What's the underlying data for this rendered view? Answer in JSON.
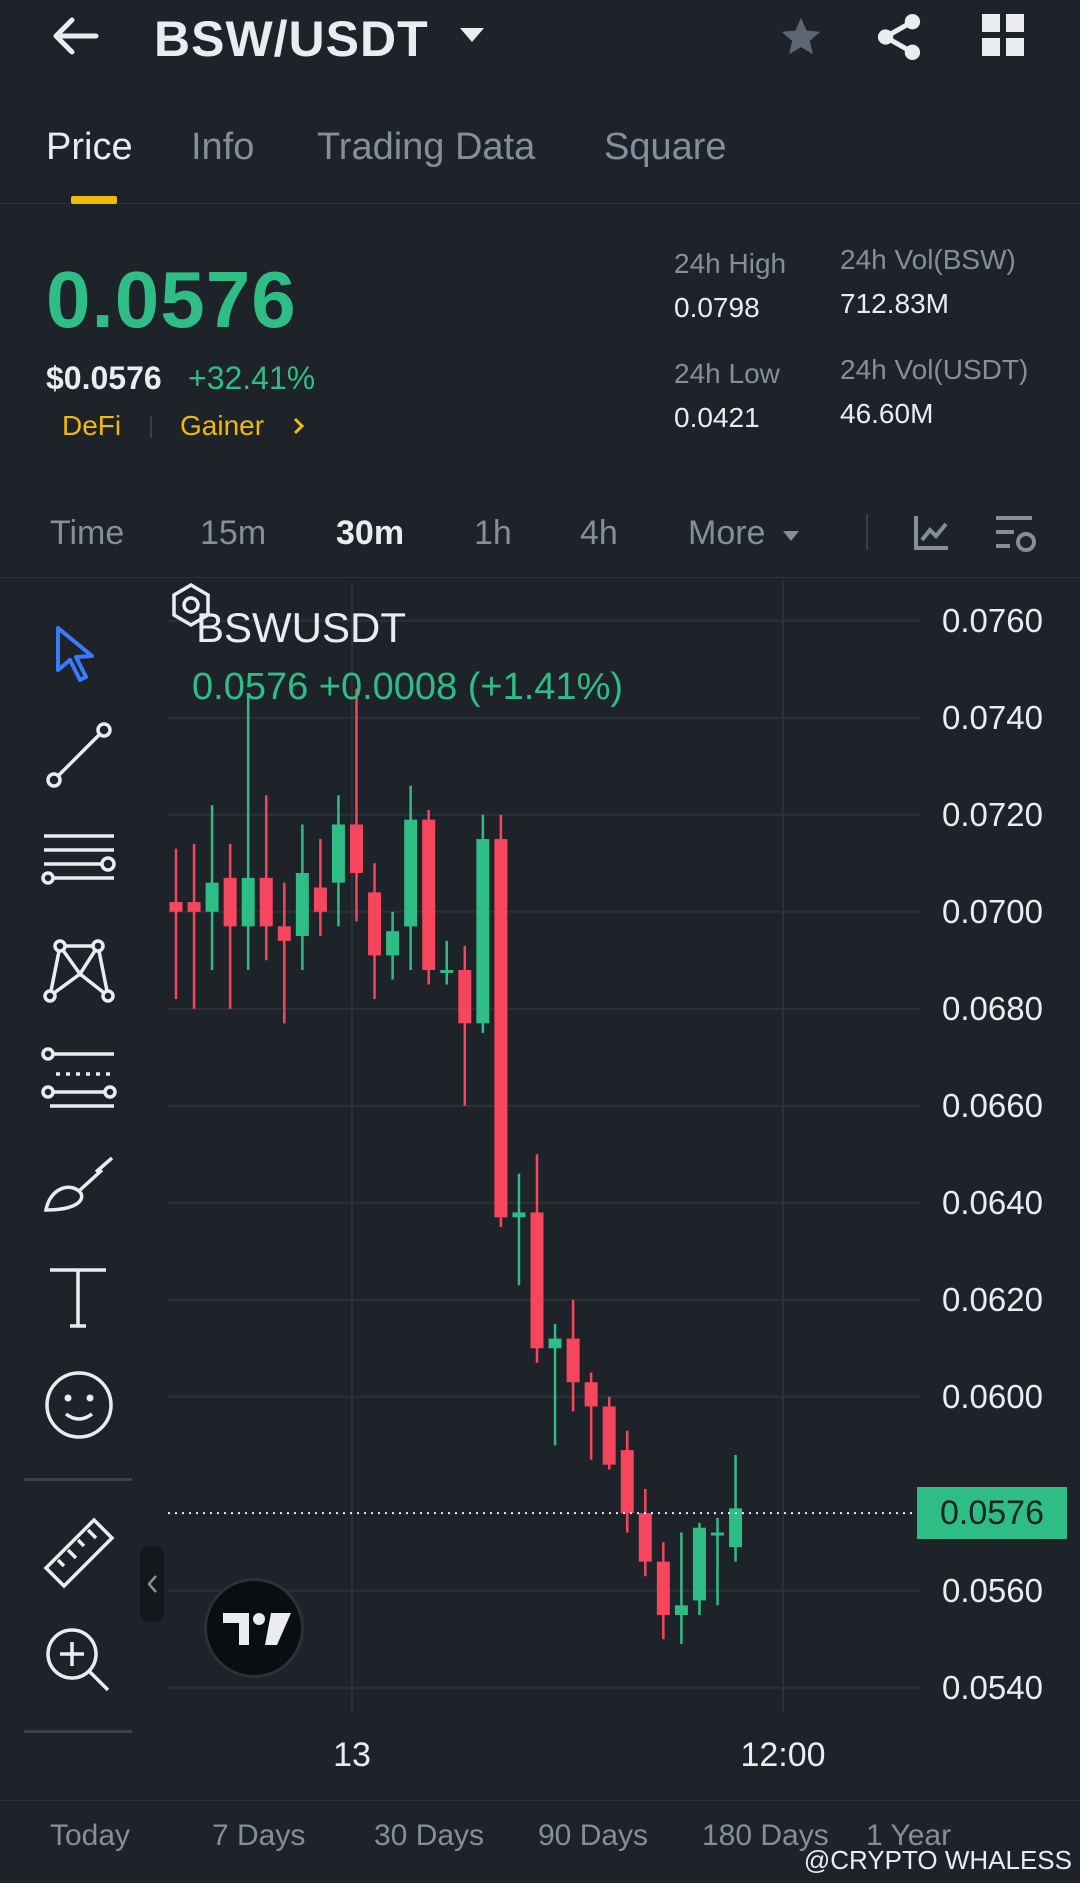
{
  "header": {
    "pair_title": "BSW/USDT",
    "icons": [
      "back-arrow-icon",
      "caret-down-icon",
      "star-icon",
      "share-icon",
      "grid-icon"
    ]
  },
  "tabs": [
    {
      "label": "Price",
      "active": true
    },
    {
      "label": "Info",
      "active": false
    },
    {
      "label": "Trading Data",
      "active": false
    },
    {
      "label": "Square",
      "active": false
    }
  ],
  "ticker": {
    "last_price": "0.0576",
    "usd_price": "$0.0576",
    "change_pct": "+32.41%",
    "tags": [
      "DeFi",
      "Gainer"
    ],
    "high_label": "24h High",
    "high_value": "0.0798",
    "low_label": "24h Low",
    "low_value": "0.0421",
    "vol_base_label": "24h Vol(BSW)",
    "vol_base_value": "712.83M",
    "vol_quote_label": "24h Vol(USDT)",
    "vol_quote_value": "46.60M"
  },
  "intervals": {
    "items": [
      "Time",
      "15m",
      "30m",
      "1h",
      "4h",
      "More"
    ],
    "active": "30m"
  },
  "chart": {
    "symbol": "BSWUSDT",
    "ohlc_line": "0.0576 +0.0008 (+1.41%)",
    "current_price_tag": "0.0576",
    "y_ticks": [
      "0.0760",
      "0.0740",
      "0.0720",
      "0.0700",
      "0.0680",
      "0.0660",
      "0.0640",
      "0.0620",
      "0.0600",
      "0.0560",
      "0.0540"
    ],
    "x_ticks": [
      "13",
      "12:00"
    ]
  },
  "chart_data": {
    "type": "candlestick",
    "title": "BSWUSDT",
    "ylim": [
      0.0535,
      0.0768
    ],
    "up_color": "#2ebd85",
    "down_color": "#f6465d",
    "last_price": 0.0576,
    "candles": [
      {
        "o": 0.0702,
        "h": 0.0713,
        "l": 0.0682,
        "c": 0.07
      },
      {
        "o": 0.0702,
        "h": 0.0714,
        "l": 0.068,
        "c": 0.07
      },
      {
        "o": 0.07,
        "h": 0.0722,
        "l": 0.0688,
        "c": 0.0706
      },
      {
        "o": 0.0707,
        "h": 0.0714,
        "l": 0.068,
        "c": 0.0697
      },
      {
        "o": 0.0697,
        "h": 0.0745,
        "l": 0.0688,
        "c": 0.0707
      },
      {
        "o": 0.0707,
        "h": 0.0724,
        "l": 0.069,
        "c": 0.0697
      },
      {
        "o": 0.0697,
        "h": 0.0706,
        "l": 0.0677,
        "c": 0.0694
      },
      {
        "o": 0.0695,
        "h": 0.0718,
        "l": 0.0688,
        "c": 0.0708
      },
      {
        "o": 0.0705,
        "h": 0.0715,
        "l": 0.0695,
        "c": 0.07
      },
      {
        "o": 0.0706,
        "h": 0.0724,
        "l": 0.0697,
        "c": 0.0718
      },
      {
        "o": 0.0718,
        "h": 0.0746,
        "l": 0.0698,
        "c": 0.0708
      },
      {
        "o": 0.0704,
        "h": 0.071,
        "l": 0.0682,
        "c": 0.0691
      },
      {
        "o": 0.0691,
        "h": 0.07,
        "l": 0.0686,
        "c": 0.0696
      },
      {
        "o": 0.0697,
        "h": 0.0726,
        "l": 0.0688,
        "c": 0.0719
      },
      {
        "o": 0.0719,
        "h": 0.0721,
        "l": 0.0685,
        "c": 0.0688
      },
      {
        "o": 0.0688,
        "h": 0.0694,
        "l": 0.0685,
        "c": 0.0688
      },
      {
        "o": 0.0688,
        "h": 0.0693,
        "l": 0.066,
        "c": 0.0677
      },
      {
        "o": 0.0677,
        "h": 0.072,
        "l": 0.0675,
        "c": 0.0715
      },
      {
        "o": 0.0715,
        "h": 0.072,
        "l": 0.0635,
        "c": 0.0637
      },
      {
        "o": 0.0637,
        "h": 0.0646,
        "l": 0.0623,
        "c": 0.0638
      },
      {
        "o": 0.0638,
        "h": 0.065,
        "l": 0.0607,
        "c": 0.061
      },
      {
        "o": 0.061,
        "h": 0.0615,
        "l": 0.059,
        "c": 0.0612
      },
      {
        "o": 0.0612,
        "h": 0.062,
        "l": 0.0597,
        "c": 0.0603
      },
      {
        "o": 0.0603,
        "h": 0.0605,
        "l": 0.0587,
        "c": 0.0598
      },
      {
        "o": 0.0598,
        "h": 0.06,
        "l": 0.0585,
        "c": 0.0586
      },
      {
        "o": 0.0589,
        "h": 0.0593,
        "l": 0.0572,
        "c": 0.0576
      },
      {
        "o": 0.0576,
        "h": 0.0581,
        "l": 0.0563,
        "c": 0.0566
      },
      {
        "o": 0.0566,
        "h": 0.057,
        "l": 0.055,
        "c": 0.0555
      },
      {
        "o": 0.0555,
        "h": 0.0572,
        "l": 0.0549,
        "c": 0.0557
      },
      {
        "o": 0.0558,
        "h": 0.0574,
        "l": 0.0555,
        "c": 0.0573
      },
      {
        "o": 0.0572,
        "h": 0.0575,
        "l": 0.0557,
        "c": 0.0572
      },
      {
        "o": 0.0569,
        "h": 0.0588,
        "l": 0.0566,
        "c": 0.0577
      }
    ]
  },
  "periods": [
    {
      "label": "Today"
    },
    {
      "label": "7 Days"
    },
    {
      "label": "30 Days"
    },
    {
      "label": "90 Days"
    },
    {
      "label": "180 Days"
    },
    {
      "label": "1 Year"
    }
  ],
  "watermark": "@CRYPTO WHALESS"
}
